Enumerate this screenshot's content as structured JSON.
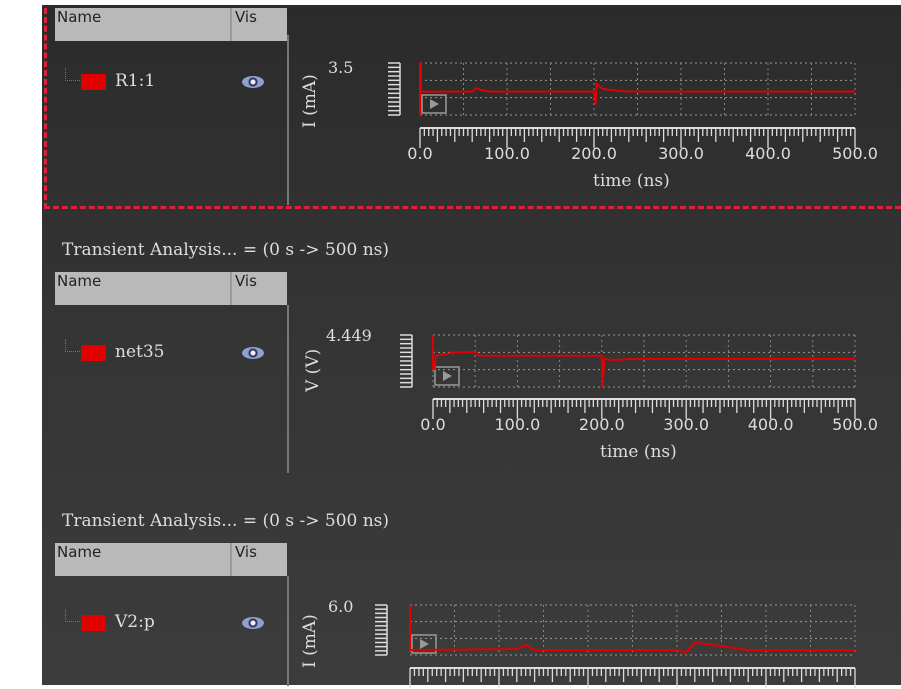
{
  "columns": {
    "name": "Name",
    "vis": "Vis"
  },
  "panels": [
    {
      "title": "",
      "signal": "R1:1",
      "ylabel": "I (mA)",
      "ymax": "3.5",
      "xlabel": "time (ns)",
      "xticks": [
        "0.0",
        "100.0",
        "200.0",
        "300.0",
        "400.0",
        "500.0"
      ],
      "selected": true,
      "wave": [
        [
          0,
          0
        ],
        [
          0,
          1
        ],
        [
          1,
          1
        ],
        [
          1,
          0.45
        ],
        [
          2,
          0.45
        ],
        [
          60,
          0.45
        ],
        [
          65,
          0.52
        ],
        [
          70,
          0.48
        ],
        [
          80,
          0.45
        ],
        [
          200,
          0.45
        ],
        [
          202,
          0.2
        ],
        [
          203,
          0.6
        ],
        [
          210,
          0.5
        ],
        [
          225,
          0.47
        ],
        [
          240,
          0.45
        ],
        [
          500,
          0.45
        ]
      ]
    },
    {
      "title": "Transient Analysis... = (0 s -> 500 ns)",
      "signal": "net35",
      "ylabel": "V (V)",
      "ymax": "4.449",
      "xlabel": "time (ns)",
      "xticks": [
        "0.0",
        "100.0",
        "200.0",
        "300.0",
        "400.0",
        "500.0"
      ],
      "selected": false,
      "wave": [
        [
          0,
          1
        ],
        [
          0,
          0.35
        ],
        [
          2,
          0.35
        ],
        [
          3,
          0.6
        ],
        [
          10,
          0.62
        ],
        [
          30,
          0.67
        ],
        [
          50,
          0.67
        ],
        [
          55,
          0.6
        ],
        [
          60,
          0.6
        ],
        [
          200,
          0.6
        ],
        [
          201,
          0
        ],
        [
          203,
          0.55
        ],
        [
          210,
          0.52
        ],
        [
          240,
          0.54
        ],
        [
          500,
          0.54
        ]
      ]
    },
    {
      "title": "Transient Analysis... = (0 s -> 500 ns)",
      "signal": "V2:p",
      "ylabel": "I (mA)",
      "ymax": "6.0",
      "xlabel": "",
      "xticks": [],
      "selected": false,
      "wave": [
        [
          0,
          1
        ],
        [
          0,
          0.1
        ],
        [
          2,
          0.1
        ],
        [
          120,
          0.12
        ],
        [
          130,
          0.2
        ],
        [
          140,
          0.1
        ],
        [
          300,
          0.1
        ],
        [
          310,
          0.05
        ],
        [
          320,
          0.25
        ],
        [
          340,
          0.2
        ],
        [
          360,
          0.15
        ],
        [
          380,
          0.1
        ],
        [
          500,
          0.1
        ]
      ]
    }
  ],
  "colors": {
    "trace": "#e00000",
    "selection": "#e0203a"
  }
}
